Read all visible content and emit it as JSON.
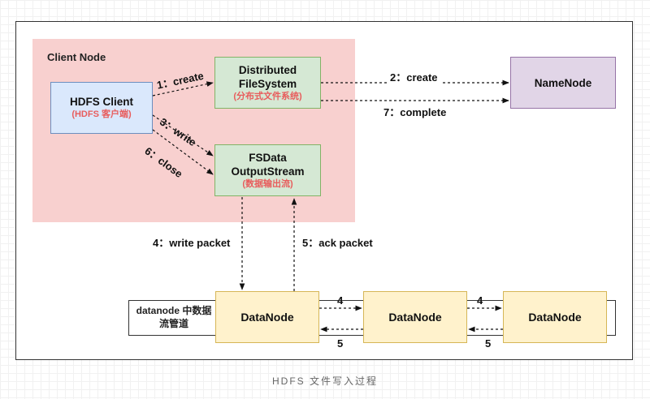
{
  "client_node": {
    "title": "Client Node"
  },
  "hdfs_client": {
    "title": "HDFS Client",
    "subtitle": "(HDFS 客户端)"
  },
  "distributed_fs": {
    "line1": "Distributed",
    "line2": "FileSystem",
    "subtitle": "(分布式文件系统)"
  },
  "fsdata": {
    "line1": "FSData",
    "line2": "OutputStream",
    "subtitle": "(数据输出流)"
  },
  "namenode": {
    "title": "NameNode"
  },
  "datanode_strip": {
    "line1": "datanode 中数据",
    "line2": "流管道"
  },
  "datanodes": [
    "DataNode",
    "DataNode",
    "DataNode"
  ],
  "edges": {
    "create1": "1：create",
    "create2": "2：create",
    "write3": "3：write",
    "close6": "6：close",
    "complete7": "7：complete",
    "write_packet4": "4：write packet",
    "ack_packet5": "5：ack packet",
    "fwd4_a": "4",
    "fwd4_b": "4",
    "ack5_a": "5",
    "ack5_b": "5"
  },
  "caption": "HDFS 文件写入过程"
}
